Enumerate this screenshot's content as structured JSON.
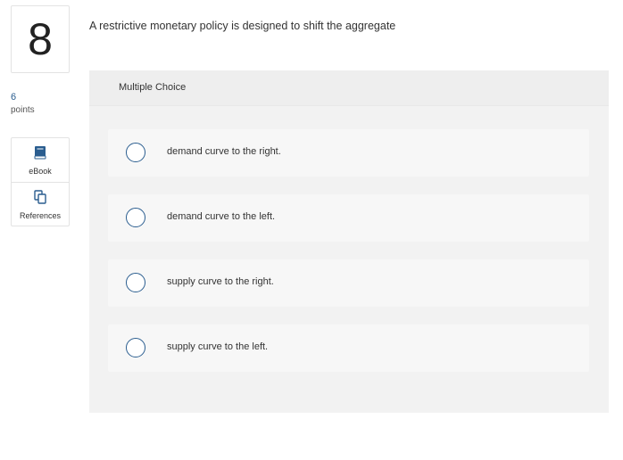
{
  "question": {
    "number": "8",
    "points_value": "6",
    "points_label": "points",
    "text": "A restrictive monetary policy is designed to shift the aggregate"
  },
  "tools": {
    "ebook": {
      "label": "eBook",
      "icon": "book-icon"
    },
    "references": {
      "label": "References",
      "icon": "copy-icon"
    }
  },
  "answer_panel": {
    "type_label": "Multiple Choice",
    "options": [
      {
        "text": "demand curve to the right."
      },
      {
        "text": "demand curve to the left."
      },
      {
        "text": "supply curve to the right."
      },
      {
        "text": "supply curve to the left."
      }
    ]
  },
  "colors": {
    "accent": "#2a5d8f",
    "panel_bg": "#f2f2f2",
    "option_bg": "#f7f7f7"
  }
}
